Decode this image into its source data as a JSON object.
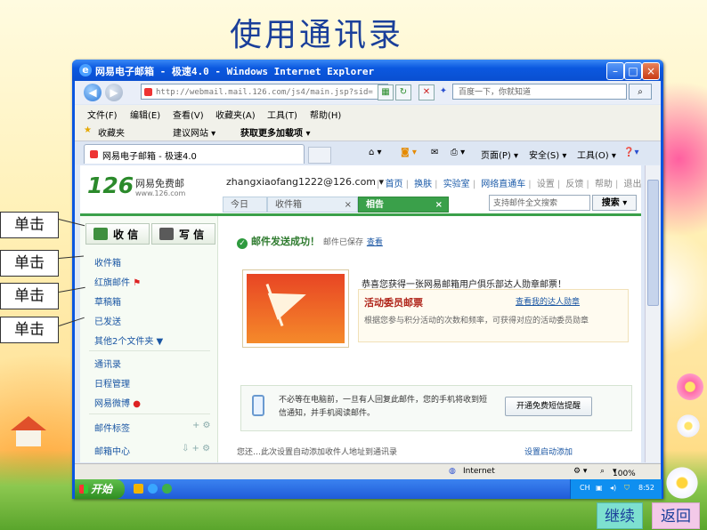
{
  "slide": {
    "title": "使用通讯录",
    "callouts": [
      "单击",
      "单击",
      "单击",
      "单击"
    ],
    "continue_label": "继续",
    "back_label": "返回"
  },
  "window": {
    "title": "网易电子邮箱 - 极速4.0 - Windows Internet Explorer",
    "address": "http://webmail.mail.126.com/js4/main.jsp?sid=",
    "search_placeholder": "百度一下，你就知道",
    "menu": [
      "文件(F)",
      "编辑(E)",
      "查看(V)",
      "收藏夹(A)",
      "工具(T)",
      "帮助(H)"
    ],
    "favorites_label": "收藏夹",
    "suggested_sites": "建议网站 ▾",
    "more_addons": "获取更多加载项 ▾",
    "tab_title": "网易电子邮箱 - 极速4.0",
    "cmd_page": "页面(P) ▾",
    "cmd_safety": "安全(S) ▾",
    "cmd_tools": "工具(O) ▾"
  },
  "mail": {
    "logo_number": "126",
    "logo_text": "网易免费邮",
    "logo_url": "www.126.com",
    "account": "zhangxiaofang1222@126.com ▾",
    "top_links": [
      "首页",
      "换肤",
      "实验室",
      "网络直通车",
      "设置",
      "反馈",
      "帮助",
      "退出"
    ],
    "top_links_pipe": "|",
    "tabs": [
      {
        "label": "今日",
        "active": false
      },
      {
        "label": "收件箱",
        "active": false
      },
      {
        "label": "相告",
        "active": true
      }
    ],
    "tab_close": "×",
    "fulltext_placeholder": "支持邮件全文搜索",
    "search_button": "搜索",
    "receive_button": "收 信",
    "write_button": "写 信",
    "folders": [
      "收件箱",
      "红旗邮件",
      "草稿箱",
      "已发送",
      "其他2个文件夹 ▼"
    ],
    "folders_flag": "⚑",
    "tools": [
      "通讯录",
      "日程管理",
      "网易微博"
    ],
    "bottom": [
      "邮件标签",
      "邮箱中心"
    ],
    "bottom_icons": [
      "+ ⚙",
      "⇩ + ⚙"
    ],
    "success_text": "邮件发送成功！",
    "saved_text": "邮件已保存",
    "view_link": "查看",
    "congrats": "恭喜您获得一张网易邮箱用户俱乐部达人勋章邮票！",
    "activity_title": "活动委员邮票",
    "activity_link": "查看我的达人勋章",
    "activity_desc": "根据您参与积分活动的次数和频率，可获得对应的活动委员勋章",
    "sms_text": "不必等在电脑前，一旦有人回复此邮件，您的手机将收到短信通知，并手机阅读邮件。",
    "sms_button": "开通免费短信提醒",
    "cut_text": "您还…此次设置自动添加收件人地址到通讯录",
    "cut_link": "设置启动添加"
  },
  "status": {
    "zone": "Internet",
    "zoom": "100%"
  },
  "taskbar": {
    "start": "开始",
    "tray_lang": "CH",
    "clock": "8:52"
  },
  "colors": {
    "mail_green": "#3aa04a",
    "link_blue": "#1a56a3",
    "title_blue": "#1a3f9a",
    "xp_blue": "#0a56e0"
  }
}
